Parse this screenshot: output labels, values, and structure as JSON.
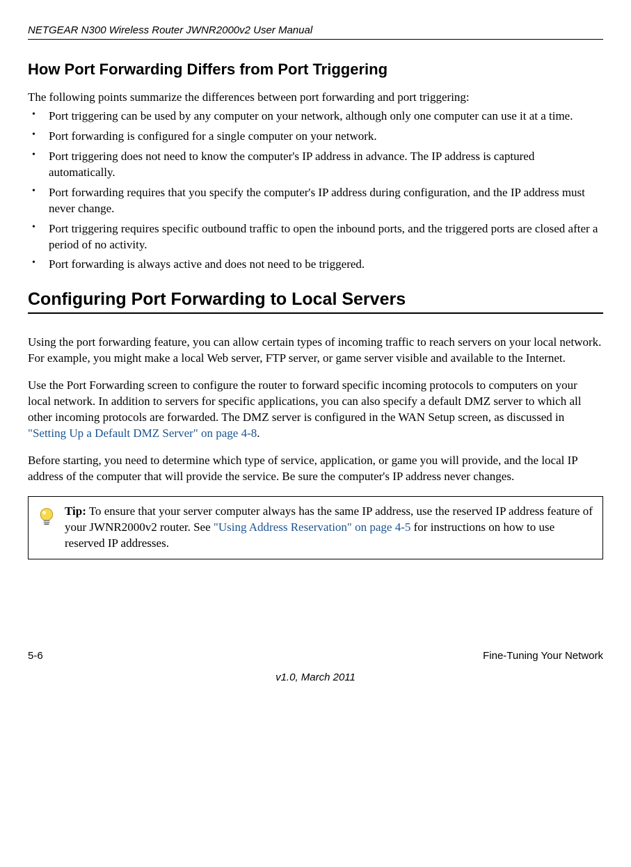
{
  "header": {
    "doc_title": "NETGEAR N300 Wireless Router JWNR2000v2 User Manual"
  },
  "section1": {
    "heading": "How Port Forwarding Differs from Port Triggering",
    "intro": "The following points summarize the differences between port forwarding and port triggering:",
    "bullets": [
      "Port triggering can be used by any computer on your network, although only one computer can use it at a time.",
      "Port forwarding is configured for a single computer on your network.",
      "Port triggering does not need to know the computer's IP address in advance. The IP address is captured automatically.",
      "Port forwarding requires that you specify the computer's IP address during configuration, and the IP address must never change.",
      "Port triggering requires specific outbound traffic to open the inbound ports, and the triggered ports are closed after a period of no activity.",
      "Port forwarding is always active and does not need to be triggered."
    ]
  },
  "section2": {
    "heading": "Configuring Port Forwarding to Local Servers",
    "para1": "Using the port forwarding feature, you can allow certain types of incoming traffic to reach servers on your local network. For example, you might make a local Web server, FTP server, or game server visible and available to the Internet.",
    "para2_before": "Use the Port Forwarding screen to configure the router to forward specific incoming protocols to computers on your local network. In addition to servers for specific applications, you can also specify a default DMZ server to which all other incoming protocols are forwarded. The DMZ server is configured in the WAN Setup screen, as discussed in ",
    "para2_link": "\"Setting Up a Default DMZ Server\" on page 4-8",
    "para2_after": ".",
    "para3": "Before starting, you need to determine which type of service, application, or game you will provide, and the local IP address of the computer that will provide the service. Be sure the computer's IP address never changes."
  },
  "tip": {
    "label": "Tip:",
    "text_before": " To ensure that your server computer always has the same IP address, use the reserved IP address feature of your JWNR2000v2 router. See ",
    "link": "\"Using Address Reservation\" on page 4-5",
    "text_after": " for instructions on how to use reserved IP addresses."
  },
  "footer": {
    "page": "5-6",
    "section": "Fine-Tuning Your Network",
    "version": "v1.0, March 2011"
  }
}
